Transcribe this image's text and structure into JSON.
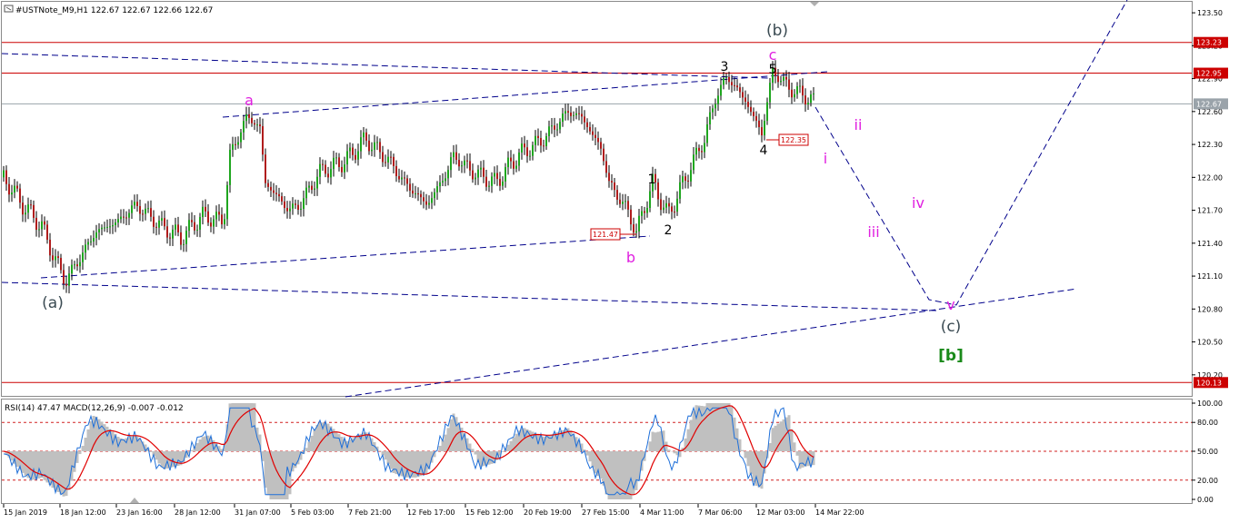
{
  "header": {
    "symbol_line": "#USTNote_M9,H1  122.67 122.67 122.66 122.67"
  },
  "indicator": {
    "title": "RSI(14) 47.47 MACD(12,26,9) -0.007 -0.012",
    "y_ticks": [
      "100.00",
      "80.00",
      "50.00",
      "20.00",
      "0.00"
    ],
    "y_values": [
      100,
      80,
      50,
      20,
      0
    ],
    "levels": [
      80,
      50,
      20
    ]
  },
  "colors": {
    "bull": "#1fa61f",
    "bear": "#b01c1c",
    "wick": "#000000",
    "trend": "#00008b",
    "horizontal": "#cc0000",
    "wave_magenta": "#e020e0",
    "wave_grey": "#3a4a52",
    "wave_black": "#000000",
    "wave_green": "#1a8a1a",
    "rsi_line": "#1e6fd9",
    "macd_fill": "#c0c0c0",
    "macd_signal": "#e00000"
  },
  "price_axis": {
    "ticks": [
      "123.50",
      "123.20",
      "122.90",
      "122.60",
      "122.30",
      "122.00",
      "121.70",
      "121.40",
      "121.10",
      "120.80",
      "120.50",
      "120.20"
    ],
    "values": [
      123.5,
      123.2,
      122.9,
      122.6,
      122.3,
      122.0,
      121.7,
      121.4,
      121.1,
      120.8,
      120.5,
      120.2
    ],
    "range": [
      120.0,
      123.6
    ],
    "markers": [
      {
        "label": "123.23",
        "value": 123.23,
        "bg": "#cc0000"
      },
      {
        "label": "122.95",
        "value": 122.95,
        "bg": "#cc0000"
      },
      {
        "label": "122.67",
        "value": 122.67,
        "bg": "#9aa3aa"
      },
      {
        "label": "120.13",
        "value": 120.13,
        "bg": "#cc0000"
      }
    ]
  },
  "time_axis": {
    "labels": [
      "15 Jan 2019",
      "18 Jan 12:00",
      "23 Jan 16:00",
      "28 Jan 12:00",
      "31 Jan 07:00",
      "5 Feb 03:00",
      "7 Feb 21:00",
      "12 Feb 17:00",
      "15 Feb 12:00",
      "20 Feb 19:00",
      "27 Feb 15:00",
      "4 Mar 11:00",
      "7 Mar 06:00",
      "12 Mar 03:00",
      "14 Mar 22:00"
    ]
  },
  "price_labels": [
    {
      "text": "121.47",
      "value": 121.47
    },
    {
      "text": "122.35",
      "value": 122.35
    }
  ],
  "wave_labels": [
    {
      "text": "a",
      "style": "magenta"
    },
    {
      "text": "b",
      "style": "magenta"
    },
    {
      "text": "c",
      "style": "magenta"
    },
    {
      "text": "(a)",
      "style": "grey"
    },
    {
      "text": "(b)",
      "style": "grey"
    },
    {
      "text": "(c)",
      "style": "grey"
    },
    {
      "text": "1",
      "style": "black"
    },
    {
      "text": "2",
      "style": "black"
    },
    {
      "text": "3",
      "style": "black"
    },
    {
      "text": "4",
      "style": "black"
    },
    {
      "text": "5",
      "style": "black"
    },
    {
      "text": "i",
      "style": "magenta"
    },
    {
      "text": "ii",
      "style": "magenta"
    },
    {
      "text": "iii",
      "style": "magenta"
    },
    {
      "text": "iv",
      "style": "magenta"
    },
    {
      "text": "v",
      "style": "magenta"
    },
    {
      "text": "[b]",
      "style": "green"
    }
  ],
  "chart_data": {
    "type": "candlestick",
    "title": "",
    "symbol": "#USTNote_M9",
    "timeframe": "H1",
    "ohlc_last": {
      "open": 122.67,
      "high": 122.67,
      "low": 122.66,
      "close": 122.67
    },
    "y_range": [
      120.0,
      123.6
    ],
    "horizontal_levels": [
      123.23,
      122.95,
      120.13
    ],
    "current_price": 122.67,
    "pivots": [
      {
        "label": "(a)",
        "price": 121.05,
        "time": "18 Jan"
      },
      {
        "label": "a",
        "price": 122.56,
        "time": "31 Jan"
      },
      {
        "label": "b",
        "price": 121.47,
        "time": "27 Feb"
      },
      {
        "label": "1",
        "price": 121.95,
        "time": "1 Mar"
      },
      {
        "label": "2",
        "price": 121.65,
        "time": "4 Mar"
      },
      {
        "label": "3",
        "price": 122.92,
        "time": "7 Mar"
      },
      {
        "label": "4",
        "price": 122.35,
        "time": "11 Mar"
      },
      {
        "label": "5",
        "price": 122.97,
        "time": "12 Mar"
      },
      {
        "label": "(b)",
        "price": 122.97,
        "time": "12 Mar"
      }
    ],
    "projection": [
      {
        "label": "current",
        "price": 122.67
      },
      {
        "label": "v / (c)",
        "price": 120.75
      },
      {
        "label": "end",
        "price": 123.6
      }
    ],
    "indicators": {
      "rsi": {
        "period": 14,
        "value": 47.47
      },
      "macd": {
        "fast": 12,
        "slow": 26,
        "signal": 9,
        "main": -0.007,
        "signal_value": -0.012
      },
      "levels": [
        80,
        50,
        20
      ]
    }
  }
}
